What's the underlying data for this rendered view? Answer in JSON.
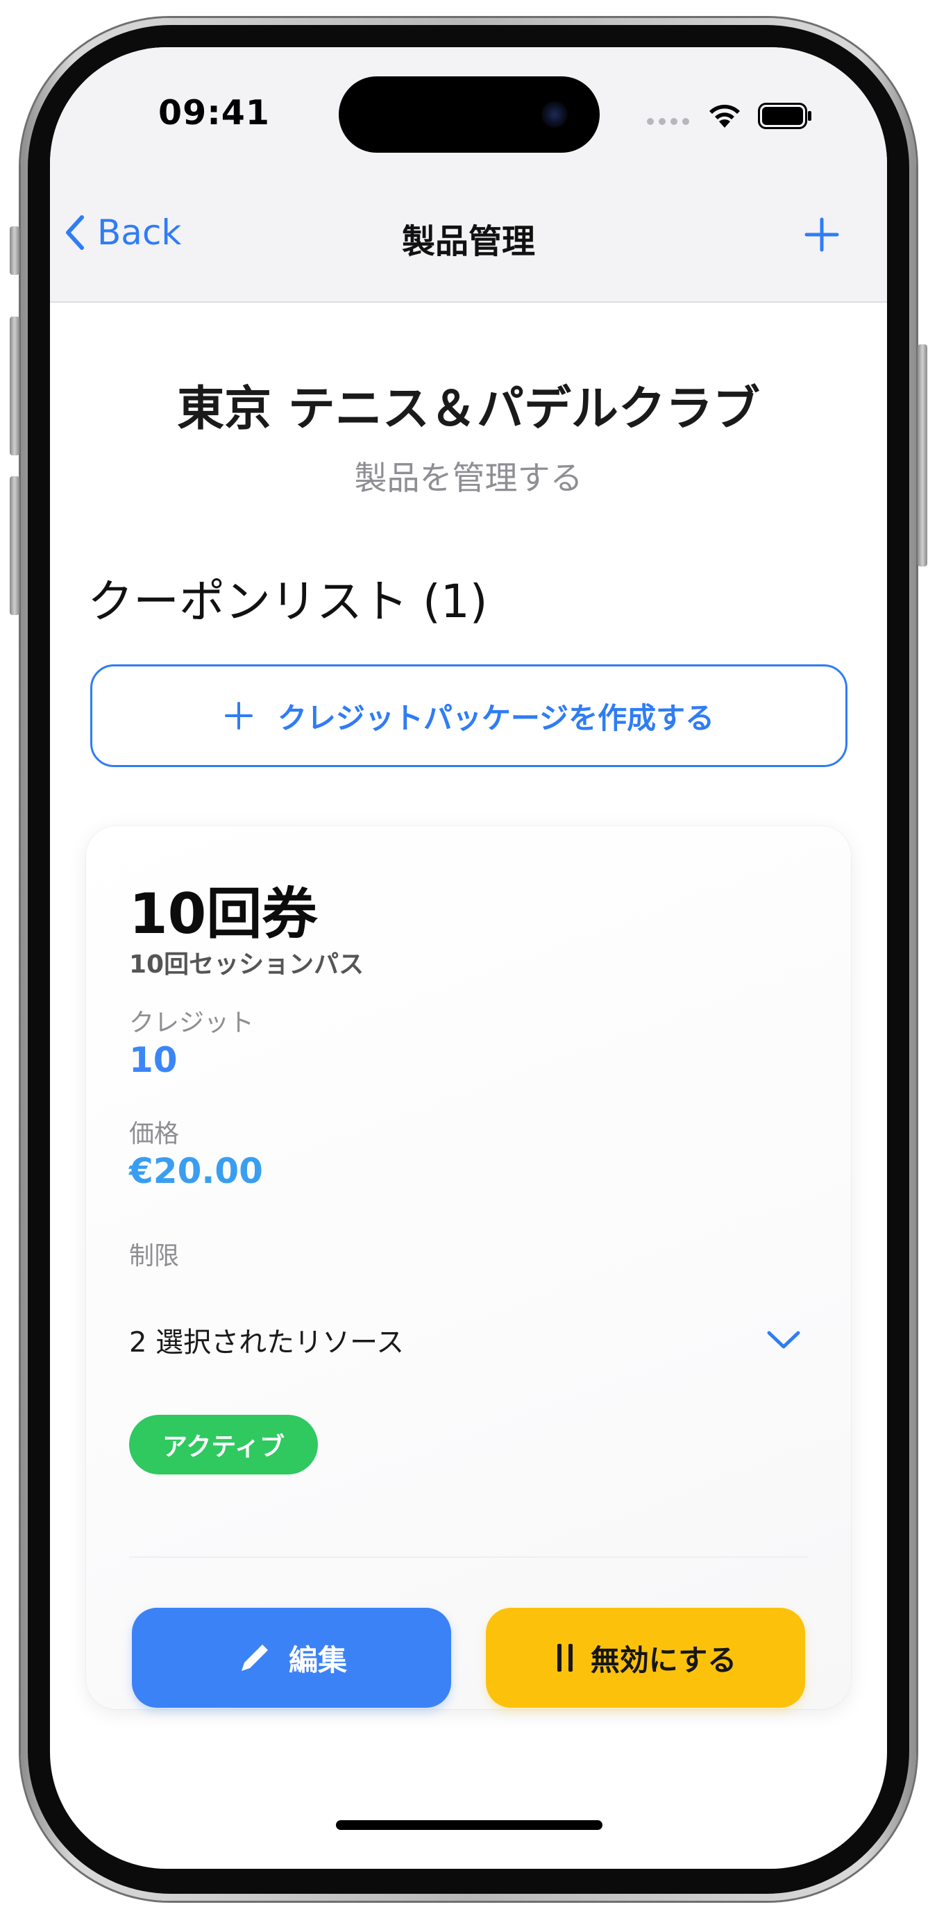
{
  "status_bar": {
    "time": "09:41"
  },
  "nav": {
    "back_label": "Back",
    "title": "製品管理",
    "add_icon": "plus-icon",
    "back_icon": "chevron-left-icon"
  },
  "header": {
    "club_name": "東京 テニス＆パデルクラブ",
    "subtitle": "製品を管理する"
  },
  "coupon_list": {
    "heading": "クーポンリスト (1)",
    "create_button_label": "クレジットパッケージを作成する"
  },
  "card": {
    "title": "10回券",
    "subtitle": "10回セッションパス",
    "credits_label": "クレジット",
    "credits_value": "10",
    "price_label": "価格",
    "price_value": "€20.00",
    "restriction_label": "制限",
    "restriction_value": "2 選択されたリソース",
    "status_badge": "アクティブ",
    "edit_label": "編集",
    "disable_label": "無効にする"
  },
  "colors": {
    "accent": "#2f7cf6",
    "active_badge": "#2fc960",
    "edit_button": "#3b82f6",
    "disable_button": "#fcc10b"
  }
}
